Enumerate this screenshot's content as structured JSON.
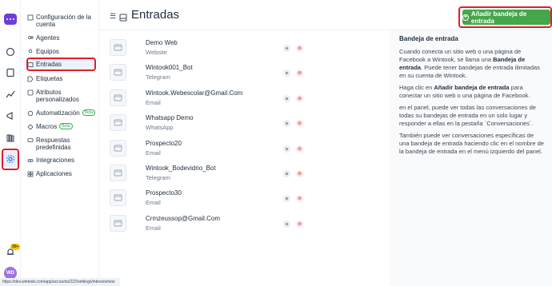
{
  "header": {
    "title": "Entradas",
    "add_button_label": "Añadir bandeja de entrada"
  },
  "sidebar": {
    "items": [
      {
        "label": "Configuración de la cuenta",
        "icon": "settings-icon"
      },
      {
        "label": "Agentes",
        "icon": "agents-icon"
      },
      {
        "label": "Equipos",
        "icon": "teams-icon"
      },
      {
        "label": "Entradas",
        "icon": "inbox-icon",
        "active": true
      },
      {
        "label": "Etiquetas",
        "icon": "tag-icon"
      },
      {
        "label": "Atributos personalizados",
        "icon": "custom-attributes-icon"
      },
      {
        "label": "Automatización",
        "icon": "automation-icon",
        "badge": "Beta"
      },
      {
        "label": "Macros",
        "icon": "macros-icon",
        "badge": "Beta"
      },
      {
        "label": "Respuestas predefinidas",
        "icon": "canned-responses-icon"
      },
      {
        "label": "Integraciones",
        "icon": "integrations-icon"
      },
      {
        "label": "Aplicaciones",
        "icon": "applications-icon"
      }
    ]
  },
  "rail": {
    "notification_badge": "99+",
    "avatar_initials": "WD"
  },
  "inboxes": [
    {
      "name": "Demo Web",
      "type": "Website"
    },
    {
      "name": "Wintook001_Bot",
      "type": "Telegram"
    },
    {
      "name": "Wintook.Webescolar@Gmail.Com",
      "type": "Email"
    },
    {
      "name": "Whatsapp Demo",
      "type": "WhatsApp"
    },
    {
      "name": "Prospecto20",
      "type": "Email"
    },
    {
      "name": "Wintook_Bodevidrio_Bot",
      "type": "Telegram"
    },
    {
      "name": "Prospecto30",
      "type": "Email"
    },
    {
      "name": "Crmzeussop@Gmail.Com",
      "type": "Email"
    }
  ],
  "info": {
    "title": "Bandeja de entrada",
    "p1_a": "Cuando conecta un sitio web o una página de Facebook a Wintook, se llama una ",
    "p1_b": "Bandeja de entrada",
    "p1_c": ". Puede tener bandejas de entrada ilimitadas en su cuenta de Wintook.",
    "p2_a": "Haga clic en ",
    "p2_b": "Añadir bandeja de entrada",
    "p2_c": " para conectar un sitio web o una página de Facebook.",
    "p3": "en el panel, puede ver todas las conversaciones de todas su bandejas de entrada en un solo lugar y responder a ellas en la pestaña `Conversaciones`.",
    "p4": "También puede ver conversaciones específicas de una bandeja de entrada haciendo clic en el nombre de la bandeja de entrada en el menú izquierdo del panel."
  },
  "statusbar": {
    "url": "https://dev.wintook.com/app/accounts/222/settings/inboxes/new"
  },
  "colors": {
    "primary_green": "#44a74a",
    "highlight_red": "#e11d2a",
    "brand_purple": "#6e3fd6"
  }
}
